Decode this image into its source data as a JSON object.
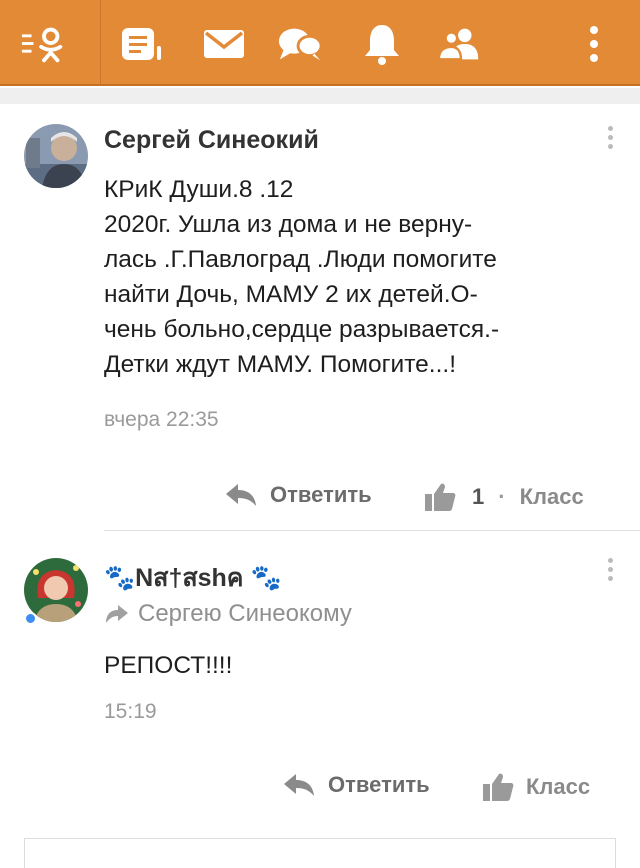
{
  "header": {
    "icons": [
      "ok-logo-menu-icon",
      "feed-icon",
      "messages-icon",
      "discussions-icon",
      "notifications-icon",
      "friends-icon",
      "more-icon"
    ],
    "color": "#e38a36"
  },
  "comments": [
    {
      "author": "Сергей Синеокий",
      "text": "КРиК Души.8 .12\n2020г. Ушла из дома и не верну-\nлась .Г.Павлоград .Люди помогите\nнайти Дочь, МАМУ 2 их детей.О-\nчень больно,сердце разрывается.-\nДетки ждут МАМУ. Помогите...!",
      "time": "вчера 22:35",
      "reply_label": "Ответить",
      "likes": "1",
      "separator": "·",
      "like_label": "Класс"
    },
    {
      "author": "🐾Nส†สshค 🐾",
      "reply_to": "Сергею Синеокому",
      "text": "РЕПОСТ!!!!",
      "time": "15:19",
      "reply_label": "Ответить",
      "like_label": "Класс"
    }
  ],
  "colors": {
    "accent": "#e38a36",
    "online": "#3c8ef0"
  }
}
